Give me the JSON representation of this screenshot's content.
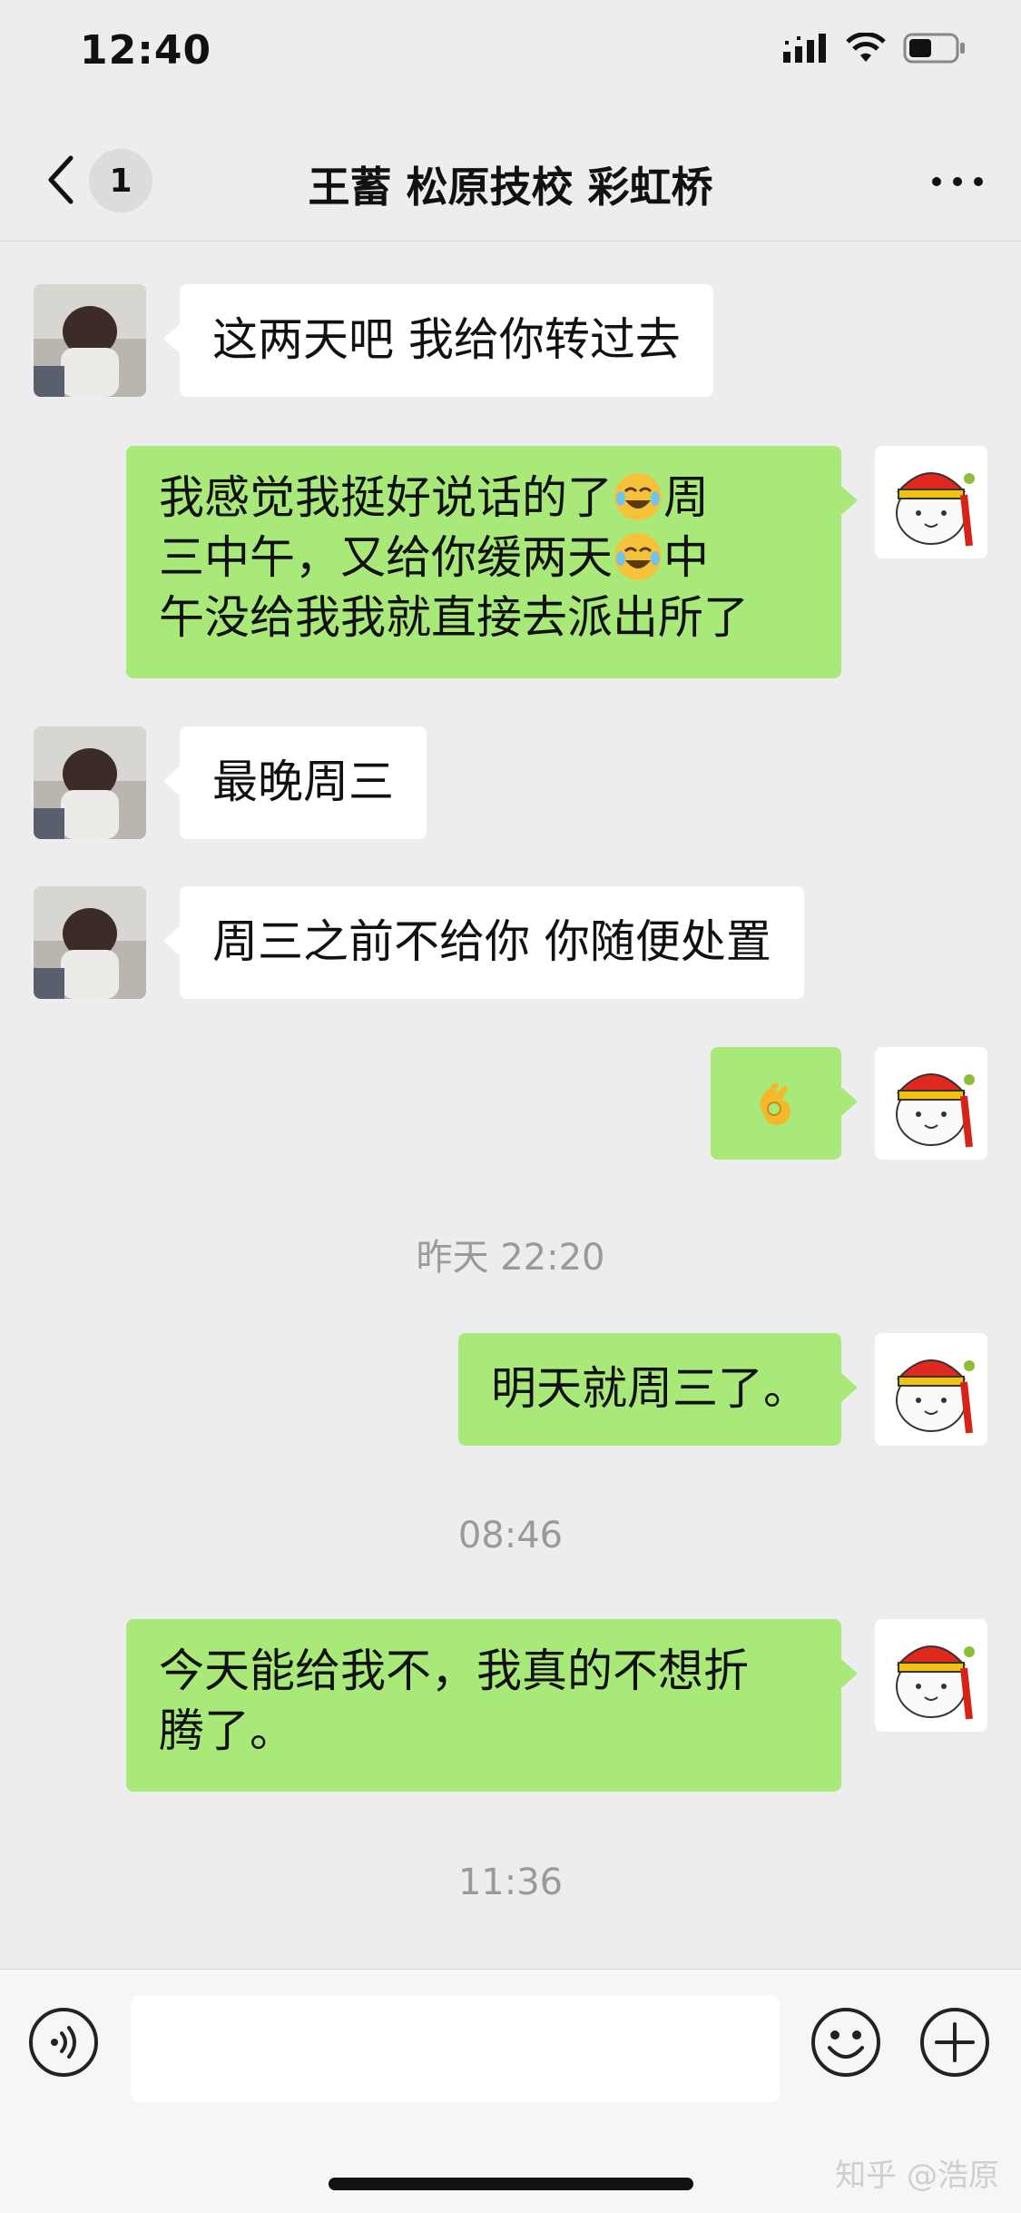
{
  "status_bar": {
    "time": "12:40"
  },
  "nav": {
    "back_badge": "1",
    "title": "王蓄 松原技校 彩虹桥"
  },
  "messages": [
    {
      "from": "them",
      "text": "这两天吧 我给你转过去"
    },
    {
      "from": "me",
      "line1": "我感觉我挺好说话的了",
      "line2a": "周",
      "line2b": "三中午，又给你缓两天",
      "line2c": "中",
      "line3": "午没给我我就直接去派出所了"
    },
    {
      "from": "them",
      "text": "最晚周三"
    },
    {
      "from": "them",
      "text": "周三之前不给你 你随便处置"
    },
    {
      "from": "me",
      "emoji": "ok-hand"
    },
    {
      "timestamp": "昨天 22:20"
    },
    {
      "from": "me",
      "text": "明天就周三了。"
    },
    {
      "timestamp": "08:46"
    },
    {
      "from": "me",
      "line1": "今天能给我不，我真的不想折",
      "line2": "腾了。"
    },
    {
      "timestamp": "11:36"
    }
  ],
  "watermark": "知乎 @浩原",
  "colors": {
    "background": "#ededed",
    "sent_bubble": "#a9e97a",
    "received_bubble": "#ffffff"
  }
}
